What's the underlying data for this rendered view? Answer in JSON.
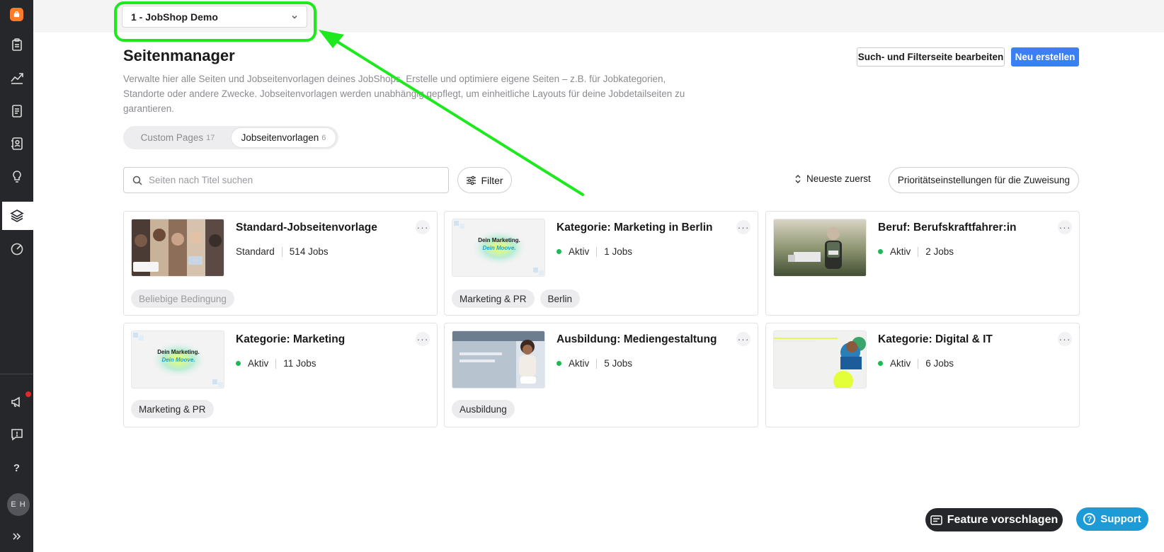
{
  "topbar": {
    "shop_selector": "1 - JobShop Demo"
  },
  "header": {
    "title": "Seitenmanager",
    "description": "Verwalte hier alle Seiten und Jobseitenvorlagen deines JobShops. Erstelle und optimiere eigene Seiten – z.B. für Jobkategorien, Standorte oder andere Zwecke. Jobseitenvorlagen werden unabhängig gepflegt, um einheitliche Layouts für deine Jobdetailseiten zu garantieren.",
    "edit_search_label": "Such- und Filterseite bearbeiten",
    "new_label": "Neu erstellen"
  },
  "tabs": [
    {
      "label": "Custom Pages",
      "count": "17"
    },
    {
      "label": "Jobseitenvorlagen",
      "count": "6"
    }
  ],
  "toolbar": {
    "search_placeholder": "Seiten nach Titel suchen",
    "filter_label": "Filter",
    "sort_label": "Neueste zuerst",
    "priority_label": "Prioritätseinstellungen für die Zuweisung"
  },
  "cards": [
    {
      "title": "Standard-Jobseitenvorlage",
      "status": "Standard",
      "jobs": "514 Jobs",
      "tags": [
        "Beliebige Bedingung"
      ]
    },
    {
      "title": "Kategorie: Marketing in Berlin",
      "status": "Aktiv",
      "jobs": "1 Jobs",
      "tags": [
        "Marketing & PR",
        "Berlin"
      ],
      "thumb_text_1": "Dein Marketing.",
      "thumb_text_2": "Dein Moove."
    },
    {
      "title": "Beruf: Berufskraftfahrer:in",
      "status": "Aktiv",
      "jobs": "2 Jobs",
      "tags": []
    },
    {
      "title": "Kategorie: Marketing",
      "status": "Aktiv",
      "jobs": "11 Jobs",
      "tags": [
        "Marketing & PR"
      ],
      "thumb_text_1": "Dein Marketing.",
      "thumb_text_2": "Dein Moove."
    },
    {
      "title": "Ausbildung: Mediengestaltung",
      "status": "Aktiv",
      "jobs": "5 Jobs",
      "tags": [
        "Ausbildung"
      ]
    },
    {
      "title": "Kategorie: Digital & IT",
      "status": "Aktiv",
      "jobs": "6 Jobs",
      "tags": []
    }
  ],
  "sidebar": {
    "avatar_initials": "E H",
    "help": "?"
  },
  "floating": {
    "feature_label": "Feature vorschlagen",
    "support_label": "Support"
  },
  "colors": {
    "sidebar_bg": "#26272b",
    "primary": "#3a7ff3",
    "active_green": "#1db954",
    "annotation_green": "#1ee81e",
    "support_blue": "#1d9bd6"
  }
}
